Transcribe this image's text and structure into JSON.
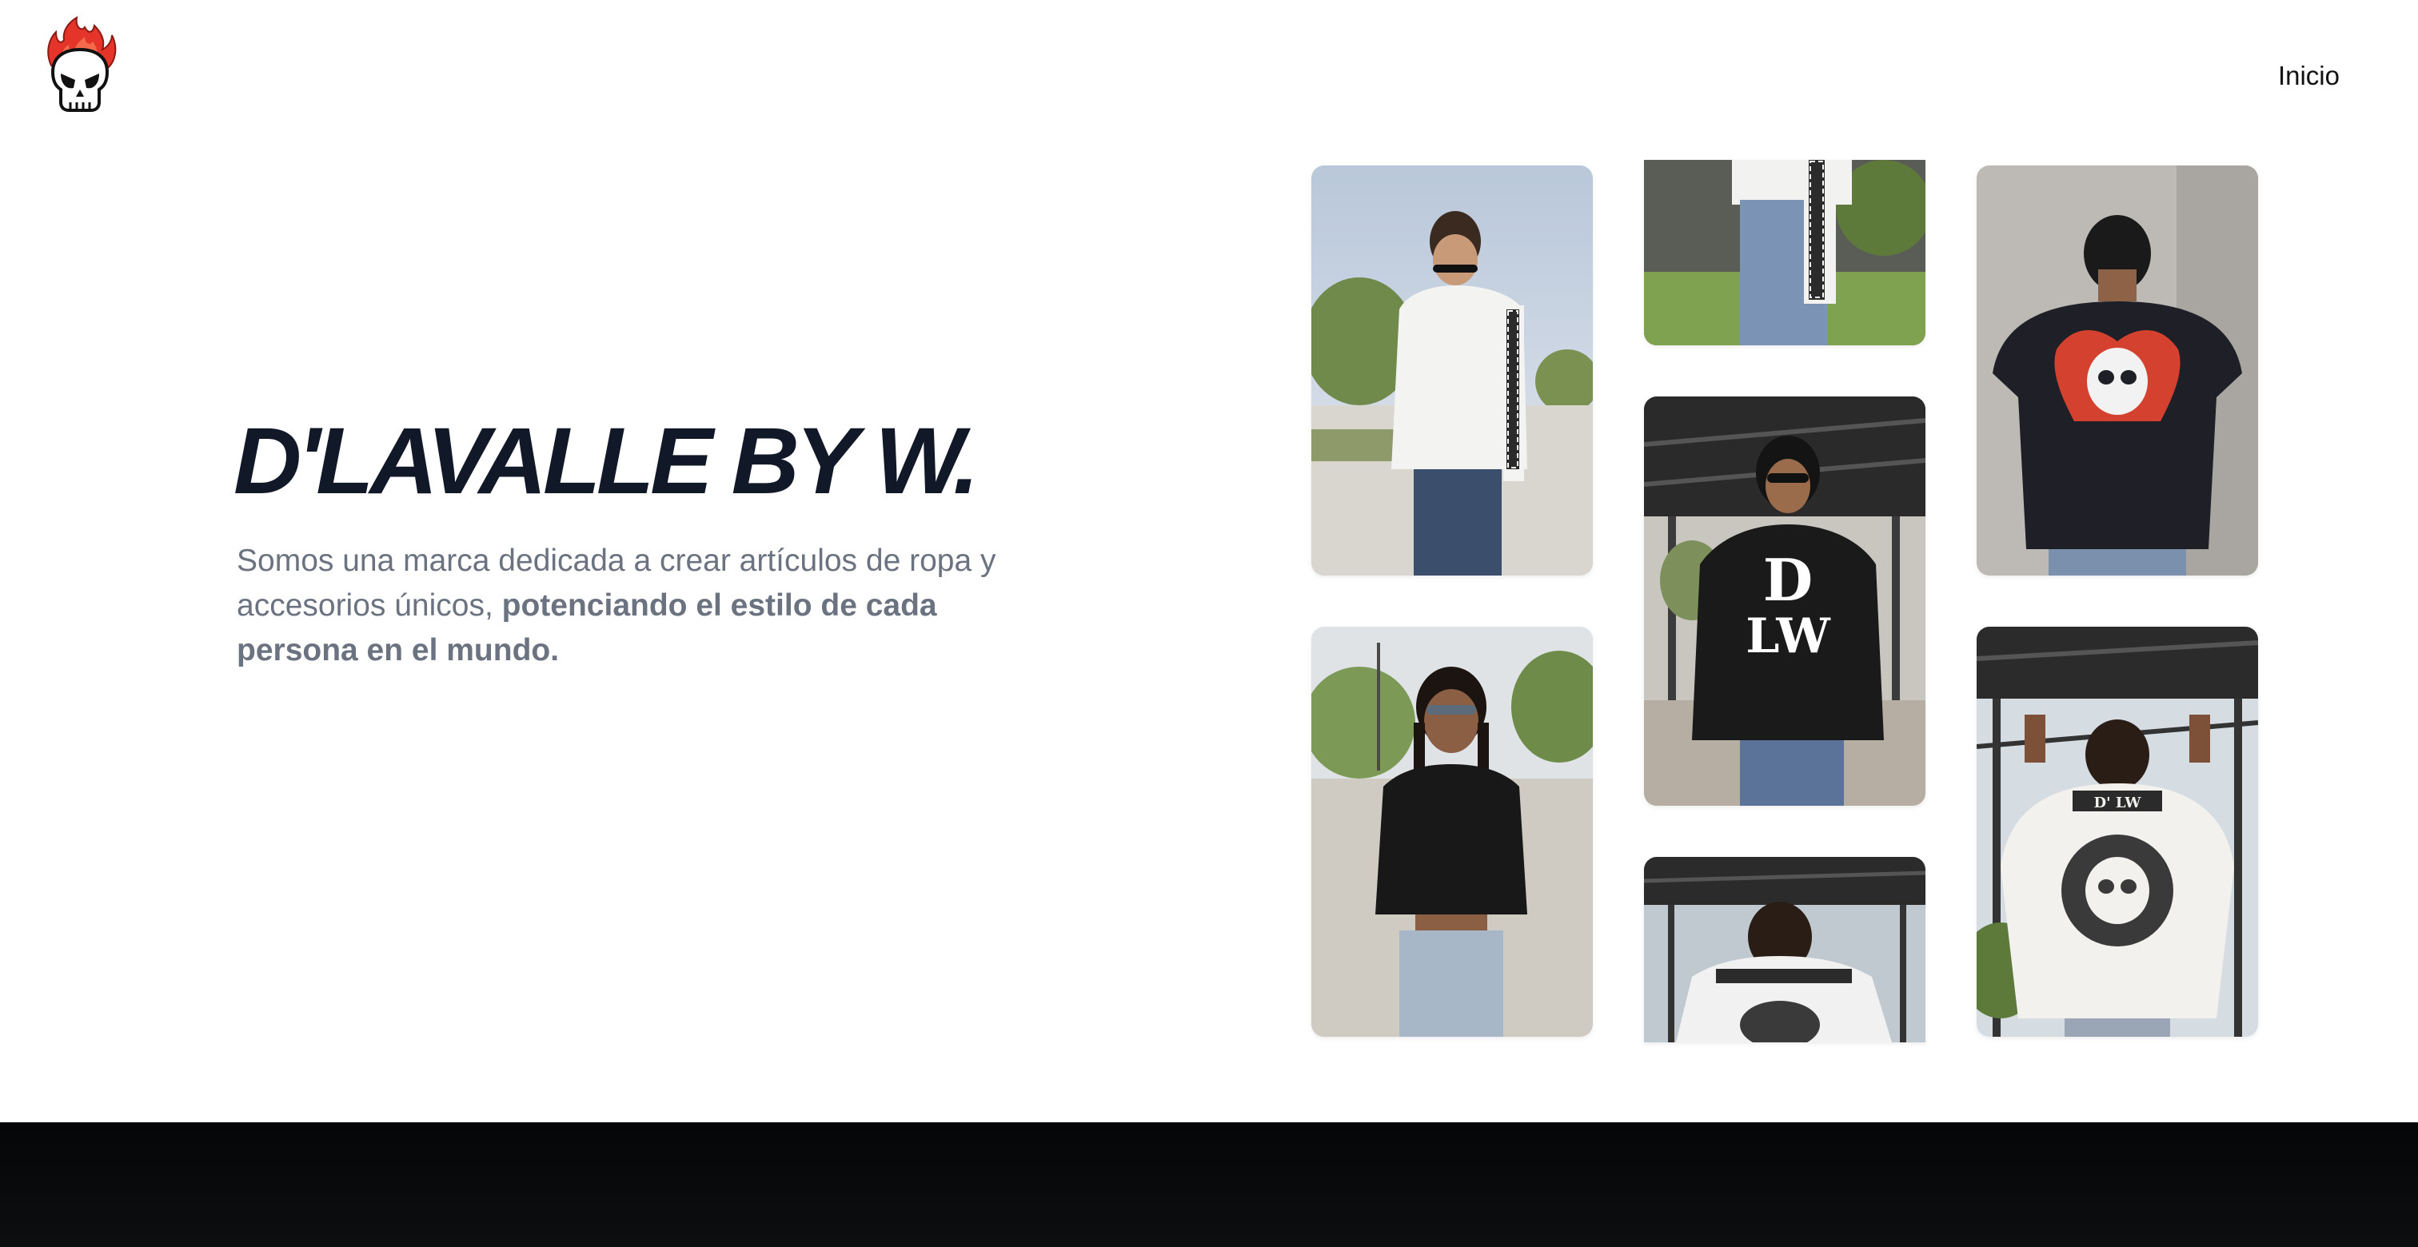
{
  "header": {
    "logo_name": "flaming-skull-logo",
    "nav": [
      {
        "label": "Inicio"
      }
    ]
  },
  "hero": {
    "title": "D'LAVALLE BY W.",
    "description_regular": "Somos una marca dedicada a crear artículos de ropa y accesorios únicos, ",
    "description_bold": "potenciando el estilo de cada persona en el mundo."
  },
  "gallery": {
    "photos": [
      {
        "name": "photo-white-longsleeve-greek-key"
      },
      {
        "name": "photo-black-crop-top"
      },
      {
        "name": "photo-white-sleeve-detail"
      },
      {
        "name": "photo-black-hoodie-dl"
      },
      {
        "name": "photo-white-hoodie-back-partial"
      },
      {
        "name": "photo-black-tee-red-skull"
      },
      {
        "name": "photo-white-hoodie-back-skull"
      }
    ]
  },
  "colors": {
    "title": "#111827",
    "text": "#6b7280",
    "flame": "#e5352b",
    "footer": "#07080a"
  }
}
